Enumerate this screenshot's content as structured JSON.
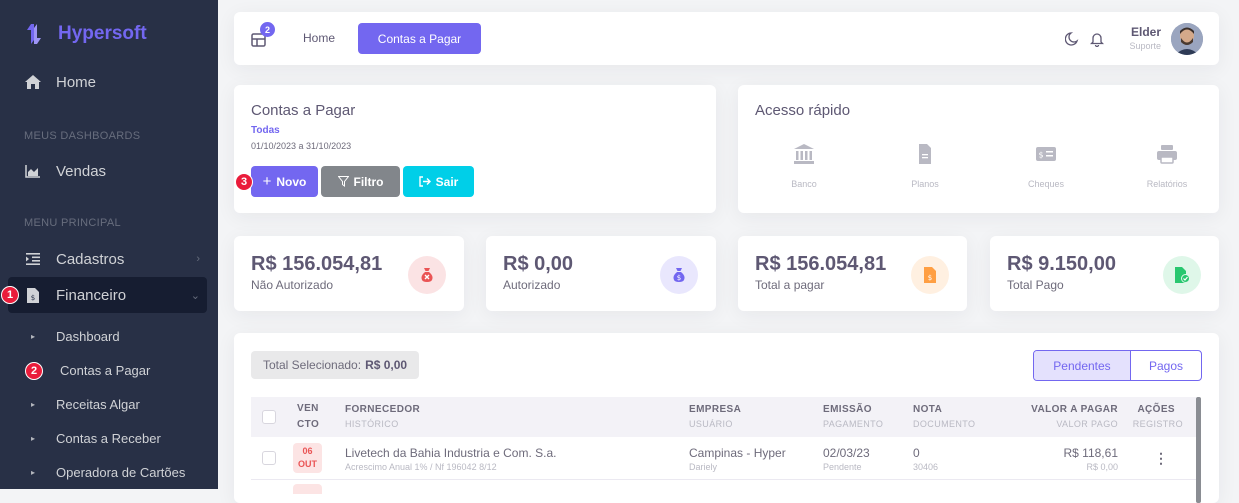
{
  "brand": {
    "name": "Hypersoft"
  },
  "sidebar": {
    "home": "Home",
    "section_dashboards": "MEUS DASHBOARDS",
    "vendas": "Vendas",
    "section_menu": "MENU PRINCIPAL",
    "cadastros": "Cadastros",
    "financeiro": "Financeiro",
    "sub_items": [
      "Dashboard",
      "Contas a Pagar",
      "Receitas Algar",
      "Contas a Receber",
      "Operadora de Cartões"
    ],
    "badges": [
      "1",
      "2",
      "3"
    ]
  },
  "topbar": {
    "grid_badge": "2",
    "home": "Home",
    "active": "Contas a Pagar",
    "user_name": "Elder",
    "user_role": "Suporte"
  },
  "header_card": {
    "title": "Contas a Pagar",
    "filter": "Todas",
    "period": "01/10/2023 a 31/10/2023",
    "btn_novo": "Novo",
    "btn_filtro": "Filtro",
    "btn_sair": "Sair"
  },
  "quick_access": {
    "title": "Acesso rápido",
    "items": [
      "Banco",
      "Planos",
      "Cheques",
      "Relatórios"
    ]
  },
  "stats": [
    {
      "value": "R$ 156.054,81",
      "label": "Não Autorizado",
      "color": "#ea5455"
    },
    {
      "value": "R$ 0,00",
      "label": "Autorizado",
      "color": "#7367f0"
    },
    {
      "value": "R$ 156.054,81",
      "label": "Total a pagar",
      "color": "#ff9f43"
    },
    {
      "value": "R$ 9.150,00",
      "label": "Total Pago",
      "color": "#28c76f"
    }
  ],
  "table": {
    "total_label": "Total Selecionado:",
    "total_value": "R$ 0,00",
    "tab_pendentes": "Pendentes",
    "tab_pagos": "Pagos",
    "headers": {
      "venc_1": "VEN",
      "venc_2": "CTO",
      "fornecedor": "FORNECEDOR",
      "historico": "HISTÓRICO",
      "empresa": "EMPRESA",
      "usuario": "USUÁRIO",
      "emissao": "EMISSÃO",
      "pagamento": "PAGAMENTO",
      "nota": "NOTA",
      "documento": "DOCUMENTO",
      "valor_pagar": "VALOR A PAGAR",
      "valor_pago": "VALOR PAGO",
      "acoes": "AÇÕES",
      "registro": "REGISTRO"
    },
    "rows": [
      {
        "day": "06",
        "month": "OUT",
        "fornecedor": "Livetech da Bahia Industria e Com. S.a.",
        "historico": "Acrescimo Anual 1% / Nf 196042 8/12",
        "empresa": "Campinas - Hyper",
        "usuario": "Dariely",
        "emissao": "02/03/23",
        "pagamento": "Pendente",
        "nota": "0",
        "documento": "30406",
        "valor_pagar": "R$ 118,61",
        "valor_pago": "R$ 0,00"
      }
    ]
  },
  "colors": {
    "primary": "#7367f0",
    "sidebar_bg": "#283046",
    "danger": "#ea5455",
    "info": "#00cfe8",
    "secondary": "#82868b"
  }
}
